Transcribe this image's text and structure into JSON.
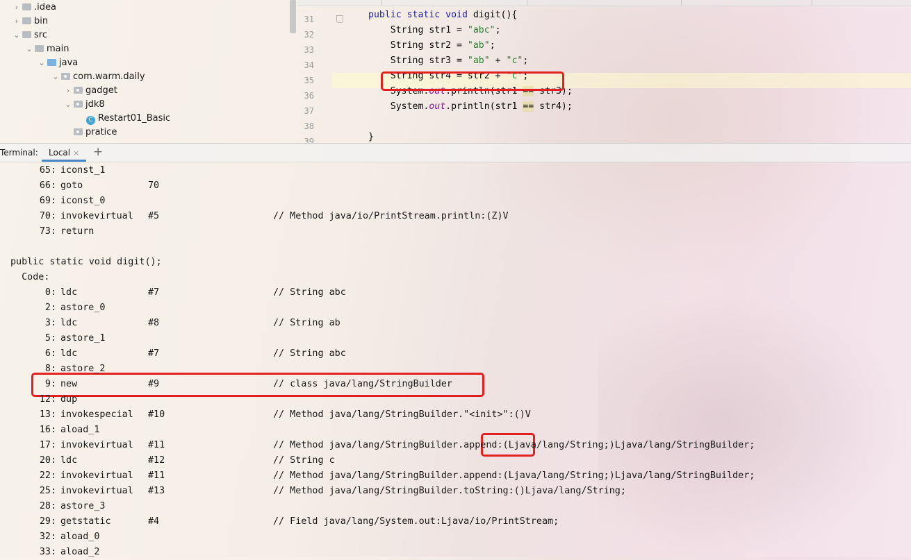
{
  "project_tree": [
    {
      "label": ".idea",
      "depth": 0,
      "expanded": false,
      "icon": "folder-icon"
    },
    {
      "label": "bin",
      "depth": 0,
      "expanded": false,
      "icon": "folder-icon"
    },
    {
      "label": "src",
      "depth": 0,
      "expanded": true,
      "icon": "folder-icon"
    },
    {
      "label": "main",
      "depth": 1,
      "expanded": true,
      "icon": "folder-icon"
    },
    {
      "label": "java",
      "depth": 2,
      "expanded": true,
      "icon": "source-folder-icon"
    },
    {
      "label": "com.warm.daily",
      "depth": 3,
      "expanded": true,
      "icon": "package-icon"
    },
    {
      "label": "gadget",
      "depth": 4,
      "expanded": false,
      "icon": "package-icon"
    },
    {
      "label": "jdk8",
      "depth": 4,
      "expanded": true,
      "icon": "package-icon"
    },
    {
      "label": "Restart01_Basic",
      "depth": 5,
      "icon": "java-class-icon",
      "icon_letter": "C"
    },
    {
      "label": "pratice",
      "depth": 4,
      "icon": "package-icon"
    }
  ],
  "editor": {
    "line_numbers": [
      "31",
      "32",
      "33",
      "34",
      "35",
      "36",
      "37",
      "38",
      "39"
    ],
    "lines": [
      {
        "kw": "public static void ",
        "text": "digit(){"
      },
      {
        "pre": "    String str1 = ",
        "str": "\"abc\"",
        "post": ";"
      },
      {
        "pre": "    String str2 = ",
        "str": "\"ab\"",
        "post": ";"
      },
      {
        "pre": "    String str3 = ",
        "str": "\"ab\"",
        "mid": " + ",
        "str2": "\"c\"",
        "post": ";"
      },
      {
        "pre": "    String str4 = str2 + ",
        "str": "\"c\"",
        "post": ";"
      },
      {
        "pre": "    System.",
        "ital": "out",
        "mid": ".println(str1 ",
        "eq": "==",
        "post": " str3);"
      },
      {
        "pre": "    System.",
        "ital": "out",
        "mid": ".println(str1 ",
        "eq": "==",
        "post": " str4);"
      },
      {
        "pre": ""
      },
      {
        "pre": "}"
      }
    ]
  },
  "terminal": {
    "title": "Terminal:",
    "tab_label": "Local",
    "tab_close": "×",
    "add_tab": "+",
    "lines": [
      {
        "offset": "65:",
        "op": "iconst_1",
        "arg": "",
        "comment": ""
      },
      {
        "offset": "66:",
        "op": "goto",
        "arg": "70",
        "comment": ""
      },
      {
        "offset": "69:",
        "op": "iconst_0",
        "arg": "",
        "comment": ""
      },
      {
        "offset": "70:",
        "op": "invokevirtual",
        "arg": "#5",
        "comment": "// Method java/io/PrintStream.println:(Z)V"
      },
      {
        "offset": "73:",
        "op": "return",
        "arg": "",
        "comment": ""
      },
      {
        "blank": true
      },
      {
        "raw": "public static void digit();"
      },
      {
        "raw": "  Code:"
      },
      {
        "offset": "0:",
        "op": "ldc",
        "arg": "#7",
        "comment": "// String abc"
      },
      {
        "offset": "2:",
        "op": "astore_0",
        "arg": "",
        "comment": ""
      },
      {
        "offset": "3:",
        "op": "ldc",
        "arg": "#8",
        "comment": "// String ab"
      },
      {
        "offset": "5:",
        "op": "astore_1",
        "arg": "",
        "comment": ""
      },
      {
        "offset": "6:",
        "op": "ldc",
        "arg": "#7",
        "comment": "// String abc"
      },
      {
        "offset": "8:",
        "op": "astore_2",
        "arg": "",
        "comment": ""
      },
      {
        "offset": "9:",
        "op": "new",
        "arg": "#9",
        "comment": "// class java/lang/StringBuilder"
      },
      {
        "offset": "12:",
        "op": "dup",
        "arg": "",
        "comment": ""
      },
      {
        "offset": "13:",
        "op": "invokespecial",
        "arg": "#10",
        "comment": "// Method java/lang/StringBuilder.\"<init>\":()V"
      },
      {
        "offset": "16:",
        "op": "aload_1",
        "arg": "",
        "comment": ""
      },
      {
        "offset": "17:",
        "op": "invokevirtual",
        "arg": "#11",
        "comment": "// Method java/lang/StringBuilder.append:(Ljava/lang/String;)Ljava/lang/StringBuilder;"
      },
      {
        "offset": "20:",
        "op": "ldc",
        "arg": "#12",
        "comment": "// String c"
      },
      {
        "offset": "22:",
        "op": "invokevirtual",
        "arg": "#11",
        "comment": "// Method java/lang/StringBuilder.append:(Ljava/lang/String;)Ljava/lang/StringBuilder;"
      },
      {
        "offset": "25:",
        "op": "invokevirtual",
        "arg": "#13",
        "comment": "// Method java/lang/StringBuilder.toString:()Ljava/lang/String;"
      },
      {
        "offset": "28:",
        "op": "astore_3",
        "arg": "",
        "comment": ""
      },
      {
        "offset": "29:",
        "op": "getstatic",
        "arg": "#4",
        "comment": "// Field java/lang/System.out:Ljava/io/PrintStream;"
      },
      {
        "offset": "32:",
        "op": "aload_0",
        "arg": "",
        "comment": ""
      },
      {
        "offset": "33:",
        "op": "aload_2",
        "arg": "",
        "comment": ""
      }
    ]
  },
  "colors": {
    "keyword": "#1a1aa6",
    "string": "#2e7d32",
    "static_field": "#871094",
    "annotation_box": "#e32020",
    "tab_underline": "#4a86c7"
  }
}
